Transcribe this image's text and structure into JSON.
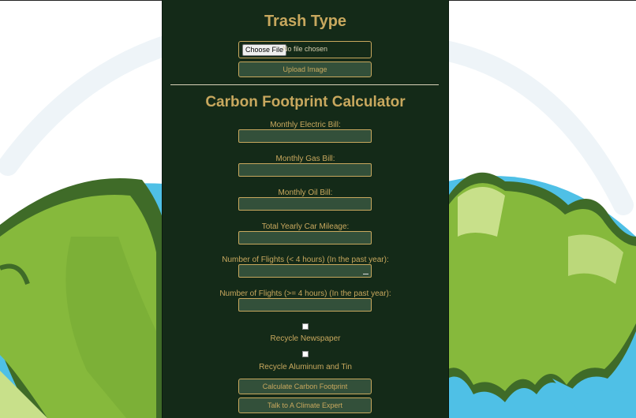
{
  "trash": {
    "title": "Trash Type",
    "choose_file_label": "Choose File",
    "no_file_text": "No file chosen",
    "upload_label": "Upload Image"
  },
  "calculator": {
    "title": "Carbon Footprint Calculator",
    "fields": [
      {
        "label": "Monthly Electric Bill:",
        "value": ""
      },
      {
        "label": "Monthly Gas Bill:",
        "value": ""
      },
      {
        "label": "Monthly Oil Bill:",
        "value": ""
      },
      {
        "label": "Total Yearly Car Mileage:",
        "value": ""
      },
      {
        "label": "Number of Flights (< 4 hours) (In the past year):",
        "value": ""
      },
      {
        "label": "Number of Flights (>= 4 hours) (In the past year):",
        "value": ""
      }
    ],
    "checkboxes": [
      {
        "label": "Recycle Newspaper",
        "checked": false
      },
      {
        "label": "Recycle Aluminum and Tin",
        "checked": false
      }
    ],
    "calculate_label": "Calculate Carbon Footprint",
    "expert_label": "Talk to A Climate Expert"
  },
  "colors": {
    "panel_bg": "#142a18",
    "accent_text": "#c8a85e",
    "button_bg": "#33503a",
    "earth_green": "#86b93c",
    "earth_dark_outline": "#3f6b28",
    "ocean_blue": "#4fc0e6"
  }
}
